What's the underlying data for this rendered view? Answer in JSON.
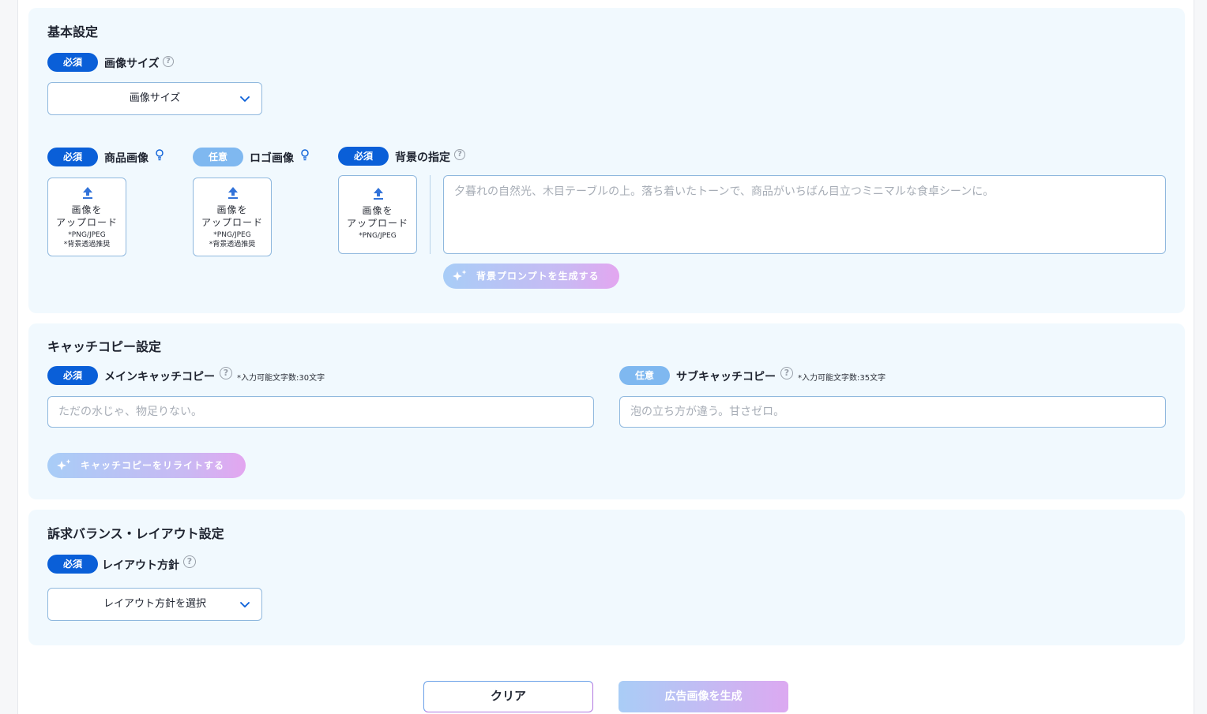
{
  "basic": {
    "title": "基本設定",
    "required": "必須",
    "optional": "任意",
    "image_size_label": "画像サイズ",
    "image_size_value": "画像サイズ",
    "product_label": "商品画像",
    "logo_label": "ロゴ画像",
    "background_label": "背景の指定",
    "upload_line1": "画像を",
    "upload_line2": "アップロード",
    "upload_fmt": "*PNG/JPEG",
    "upload_trans": "*背景透過推奨",
    "background_placeholder": "夕暮れの自然光、木目テーブルの上。落ち着いたトーンで、商品がいちばん目立つミニマルな食卓シーンに。",
    "bg_prompt_button": "背景プロンプトを生成する"
  },
  "catch": {
    "title": "キャッチコピー設定",
    "main_label": "メインキャッチコピー",
    "main_note": "*入力可能文字数:30文字",
    "main_placeholder": "ただの水じゃ、物足りない。",
    "sub_label": "サブキャッチコピー",
    "sub_note": "*入力可能文字数:35文字",
    "sub_placeholder": "泡の立ち方が違う。甘さゼロ。",
    "rewrite_button": "キャッチコピーをリライトする"
  },
  "layout": {
    "title": "訴求バランス・レイアウト設定",
    "policy_label": "レイアウト方針",
    "policy_value": "レイアウト方針を選択"
  },
  "footer": {
    "clear": "クリア",
    "generate": "広告画像を生成"
  },
  "colors": {
    "required_badge": "#0a5fd8",
    "optional_badge": "#7fb8f0",
    "card_bg": "#f1f9fe"
  }
}
